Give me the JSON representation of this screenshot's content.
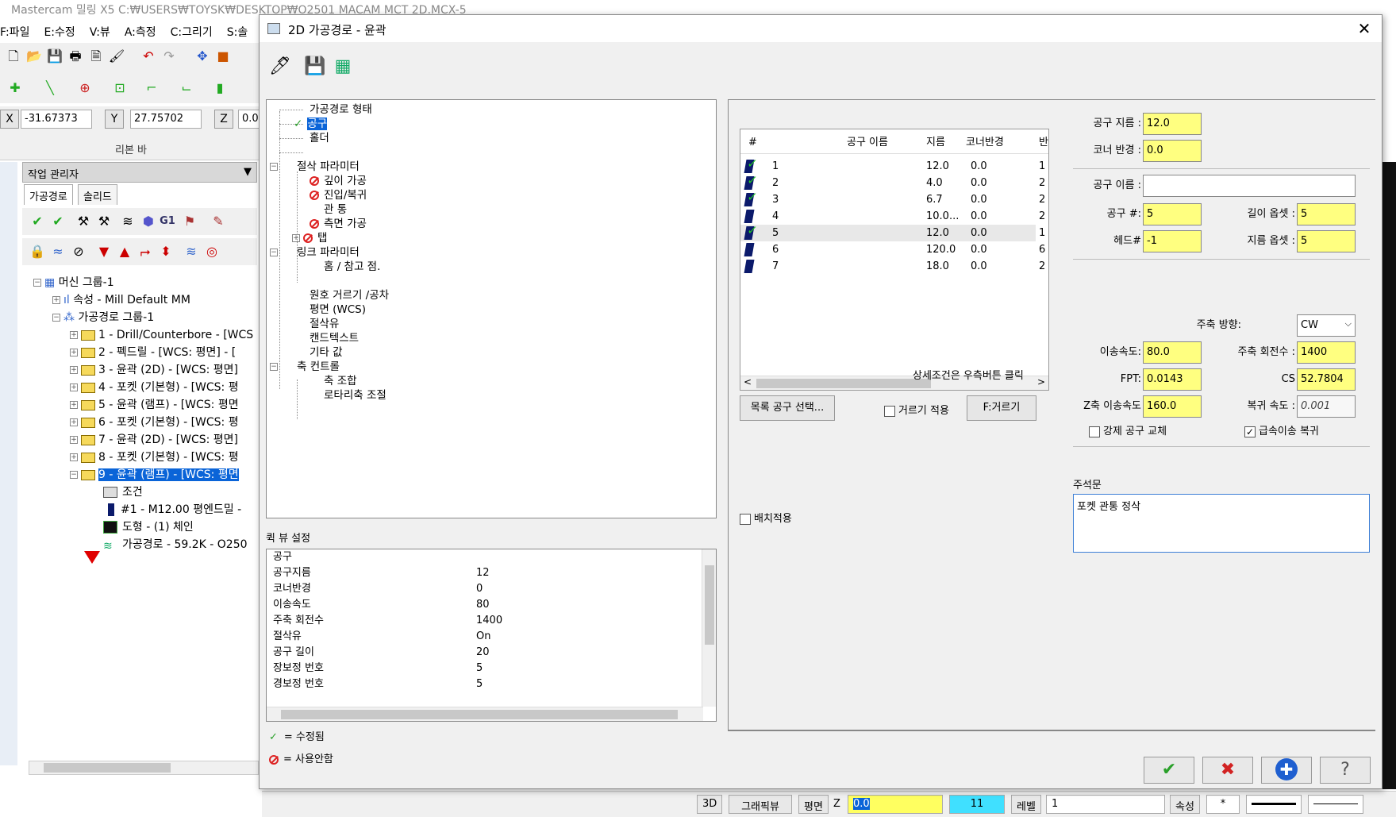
{
  "app": {
    "title": "Mastercam 밀링 X5   C:₩USERS₩TOYSK₩DESKTOP₩O2501 MACAM MCT 2D.MCX-5",
    "menu": [
      "F:파일",
      "E:수정",
      "V:뷰",
      "A:측정",
      "C:그리기",
      "S:솔"
    ],
    "coords": {
      "x_label": "X",
      "x_value": "-31.67373",
      "y_label": "Y",
      "y_value": "27.75702",
      "z_label": "Z",
      "z_value": "0.0"
    },
    "ribbon_label": "리본 바"
  },
  "ops_manager": {
    "header": "작업 관리자",
    "tabs": [
      "가공경로",
      "솔리드"
    ],
    "tree": [
      {
        "label": "머신 그룹-1"
      },
      {
        "label": "속성 - Mill Default MM"
      },
      {
        "label": "가공경로 그룹-1"
      },
      {
        "label": "1 - Drill/Counterbore - [WCS"
      },
      {
        "label": "2 - 펙드릴 - [WCS: 평면] - ["
      },
      {
        "label": "3 - 윤곽 (2D) - [WCS: 평면]"
      },
      {
        "label": "4 - 포켓 (기본형) - [WCS: 평"
      },
      {
        "label": "5 - 윤곽 (램프) - [WCS: 평면"
      },
      {
        "label": "6 - 포켓 (기본형) - [WCS: 평"
      },
      {
        "label": "7 - 윤곽 (2D) - [WCS: 평면]"
      },
      {
        "label": "8 - 포켓 (기본형) - [WCS: 평"
      },
      {
        "label": "9 - 윤곽 (램프) - [WCS: 평면"
      },
      {
        "label": "조건"
      },
      {
        "label": "#1 - M12.00 평엔드밀 -"
      },
      {
        "label": "도형 - (1) 체인"
      },
      {
        "label": "가공경로 - 59.2K - O250"
      }
    ]
  },
  "dialog": {
    "title": "2D 가공경로 - 윤곽",
    "tree": [
      "가공경로 형태",
      "공구",
      "홀더",
      "절삭 파라미터",
      "깊이 가공",
      "진입/복귀",
      "관 통",
      "측면 가공",
      "탭",
      "링크 파라미터",
      "홈 / 참고 점.",
      "원호 거르기 /공차",
      "평면 (WCS)",
      "절삭유",
      "캔드텍스트",
      "기타 값",
      "축 컨트롤",
      "축 조합",
      "로타리축 조절"
    ],
    "quick_view_label": "퀵 뷰 설정",
    "quick_view": [
      {
        "k": "공구",
        "v": ""
      },
      {
        "k": "공구지름",
        "v": "12"
      },
      {
        "k": "코너반경",
        "v": "0"
      },
      {
        "k": "이송속도",
        "v": "80"
      },
      {
        "k": "주축 회전수",
        "v": "1400"
      },
      {
        "k": "절삭유",
        "v": "On"
      },
      {
        "k": "공구 길이",
        "v": "20"
      },
      {
        "k": "장보정 번호",
        "v": "5"
      },
      {
        "k": "경보정 번호",
        "v": "5"
      }
    ],
    "legend_modified": "= 수정됨",
    "legend_disabled": "= 사용안함",
    "tool_list": {
      "headers": [
        "#",
        "공구 이름",
        "지름",
        "코너반경",
        "반"
      ],
      "rows": [
        {
          "n": "1",
          "d": "12.0",
          "r": "0.0",
          "e": "1"
        },
        {
          "n": "2",
          "d": "4.0",
          "r": "0.0",
          "e": "2"
        },
        {
          "n": "3",
          "d": "6.7",
          "r": "0.0",
          "e": "2"
        },
        {
          "n": "4",
          "d": "10.0...",
          "r": "0.0",
          "e": "2"
        },
        {
          "n": "5",
          "d": "12.0",
          "r": "0.0",
          "e": "1"
        },
        {
          "n": "6",
          "d": "120.0",
          "r": "0.0",
          "e": "6"
        },
        {
          "n": "7",
          "d": "18.0",
          "r": "0.0",
          "e": "2"
        }
      ]
    },
    "hint": "상세조건은 우측버튼 클릭",
    "btn_select_tool": "목록 공구 선택...",
    "chk_filter": "거르기 적용",
    "btn_filter": "F:거르기",
    "chk_batch": "배치적용",
    "fields": {
      "tool_dia_label": "공구 지름 :",
      "tool_dia": "12.0",
      "corner_label": "코너 반경 :",
      "corner": "0.0",
      "tool_name_label": "공구 이름 :",
      "tool_name": "",
      "tool_no_label": "공구 #:",
      "tool_no": "5",
      "len_off_label": "길이 옵셋 :",
      "len_off": "5",
      "head_label": "헤드#",
      "head": "-1",
      "dia_off_label": "지름 옵셋 :",
      "dia_off": "5",
      "spin_dir_label": "주축 방향:",
      "spin_dir": "CW",
      "feed_label": "이송속도:",
      "feed": "80.0",
      "rpm_label": "주축 회전수 :",
      "rpm": "1400",
      "fpt_label": "FPT:",
      "fpt": "0.0143",
      "cs_label": "CS",
      "cs": "52.7804",
      "plunge_label": "Z축 이송속도",
      "plunge": "160.0",
      "retract_label": "복귀 속도 :",
      "retract": "0.001",
      "force_tc": "강제 공구 교체",
      "rapid_retract": "급속이송 복귀"
    },
    "comment_label": "주석문",
    "comment": "포켓 관통 정삭"
  },
  "status": {
    "view3d": "3D",
    "graphic_view": "그래픽뷰",
    "plane": "평면",
    "z_label": "Z",
    "z_value": "0.0",
    "level_num": "11",
    "level_label": "레벨",
    "level_value": "1",
    "attr": "속성",
    "star": "*"
  },
  "colors": {
    "accent": "#0a64d8",
    "field_yellow": "#ffff80",
    "check_green": "#2aa02a",
    "cancel_red": "#d22222"
  }
}
